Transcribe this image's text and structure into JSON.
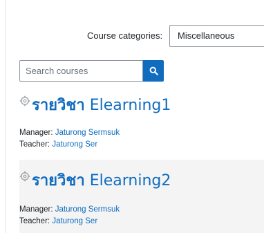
{
  "filter": {
    "label": "Course categories:",
    "selected": "Miscellaneous"
  },
  "search": {
    "placeholder": "Search courses",
    "button_icon": "search-icon"
  },
  "courses": [
    {
      "title_thai": "รายวิชา",
      "title_name": "Elearning1",
      "icon": "course-cog-icon",
      "contacts": [
        {
          "role": "Manager",
          "name": "Jaturong Sermsuk"
        },
        {
          "role": "Teacher",
          "name": "Jaturong Ser"
        }
      ]
    },
    {
      "title_thai": "รายวิชา",
      "title_name": "Elearning2",
      "icon": "course-cog-icon",
      "contacts": [
        {
          "role": "Manager",
          "name": "Jaturong Sermsuk"
        },
        {
          "role": "Teacher",
          "name": "Jaturong Ser"
        }
      ]
    }
  ],
  "colors": {
    "accent": "#0f6cbf",
    "alt_row": "#f4f4f5"
  },
  "separators": {
    "label_sep": ": ",
    "title_sep": " "
  }
}
